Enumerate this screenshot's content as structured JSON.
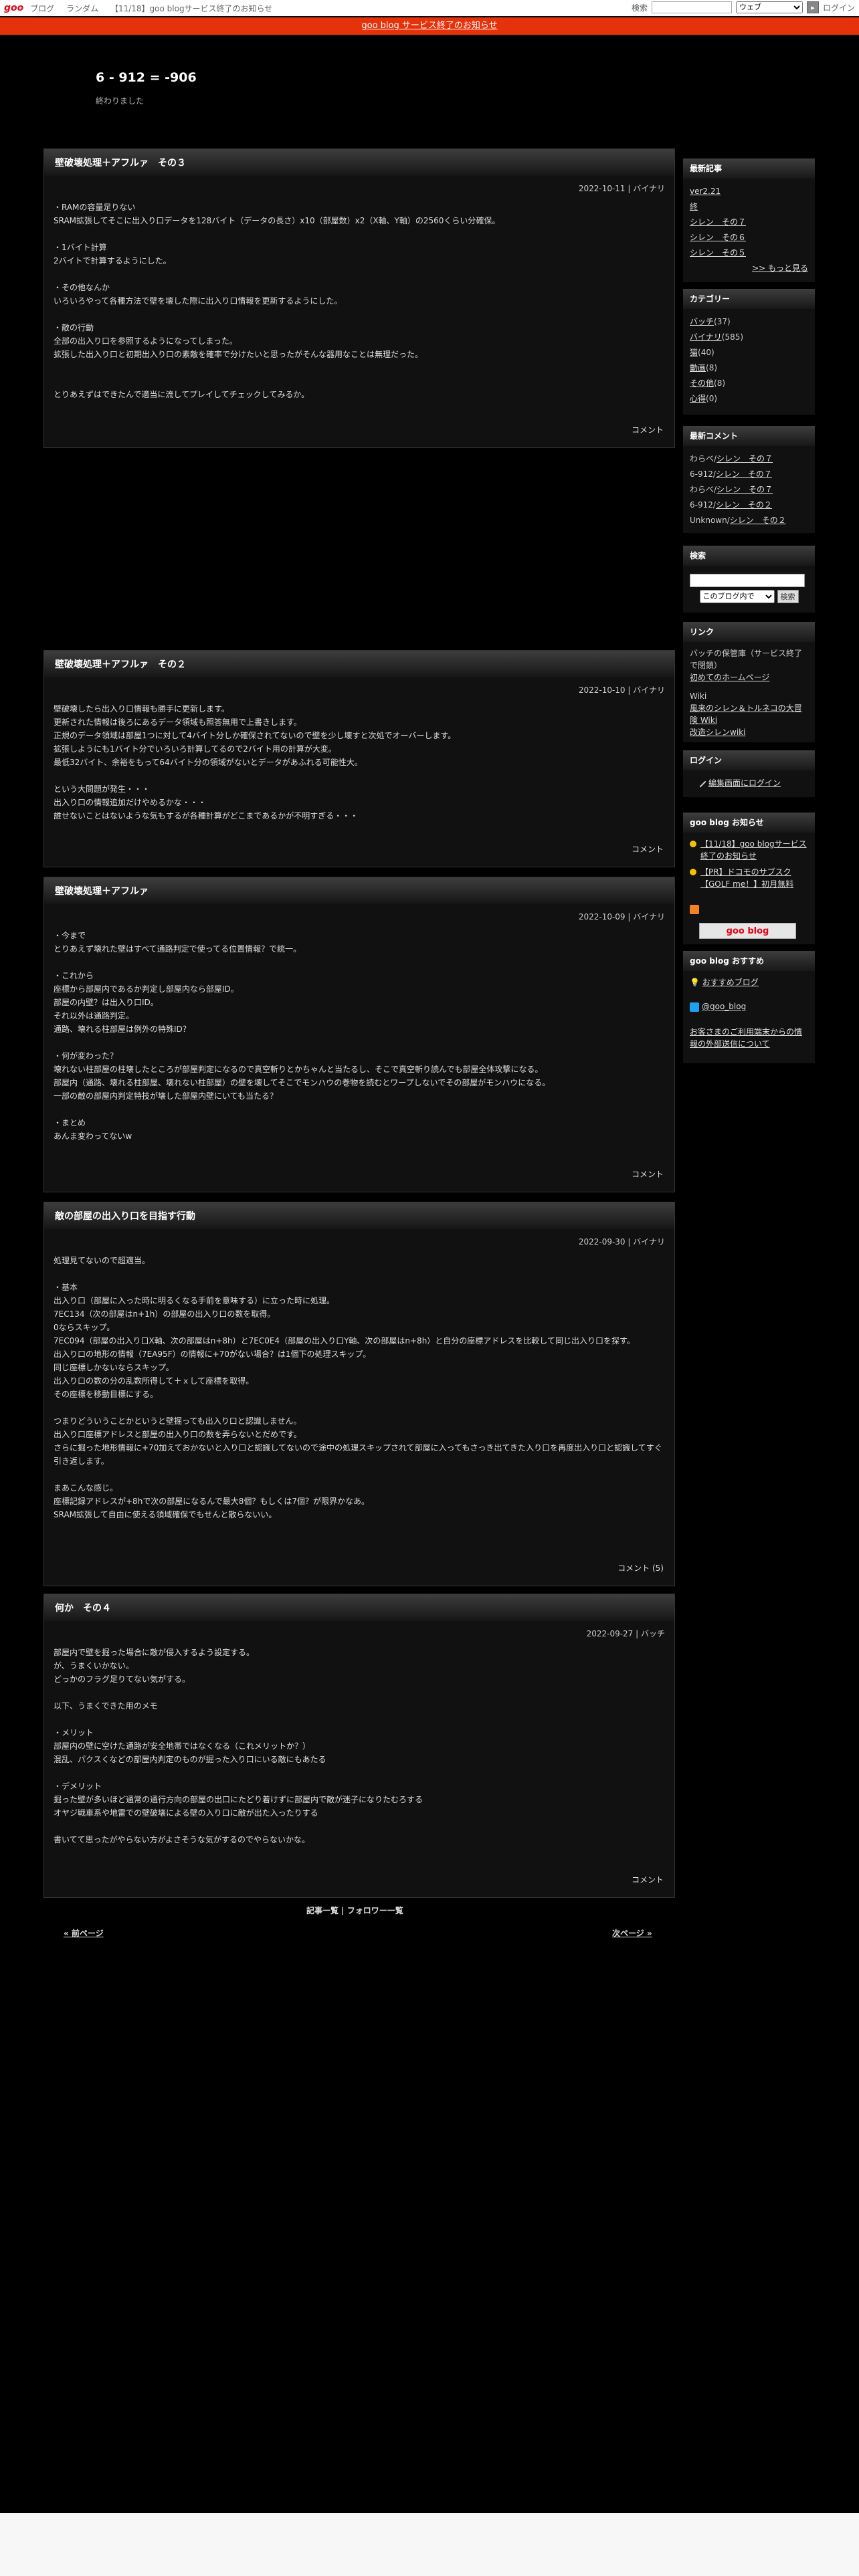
{
  "topbar": {
    "logo": "goo",
    "nav": [
      "ブログ",
      "ランダム",
      "【11/18】goo blogサービス終了のお知らせ"
    ],
    "search_label": "検索",
    "search_scope": "ウェブ",
    "login": "ログイン"
  },
  "notice": "goo blog サービス終了のお知らせ",
  "blog": {
    "title": "6 - 912 = -906",
    "description": "終わりました"
  },
  "posts": [
    {
      "title": "壁破壊処理＋アフルァ　その３",
      "meta": "2022-10-11 | バイナリ",
      "body": "・RAMの容量足りない\nSRAM拡張してそこに出入り口データを128バイト（データの長さ）x10（部屋数）x2（X軸、Y軸）の2560くらい分確保。\n\n・1バイト計算\n2バイトで計算するようにした。\n\n・その他なんか\nいろいろやって各種方法で壁を壊した際に出入り口情報を更新するようにした。\n\n・敵の行動\n全部の出入り口を参照するようになってしまった。\n拡張した出入り口と初期出入り口の素敵を確率で分けたいと思ったがそんな器用なことは無理だった。\n\n\nとりあえずはできたんで適当に流してプレイしてチェックしてみるか。",
      "comment": "コメント"
    },
    {
      "title": "壁破壊処理＋アフルァ　その２",
      "meta": "2022-10-10 | バイナリ",
      "body": "壁破壊したら出入り口情報も勝手に更新します。\n更新された情報は後ろにあるデータ領域も照答無用で上書きします。\n正規のデータ領域は部屋1つに対して4バイト分しか確保されてないので壁を少し壊すと次処でオーバーします。\n拡張しようにも1バイト分でいろいろ計算してるので2バイト用の計算が大変。\n最低32バイト、余裕をもって64バイト分の領域がないとデータがあふれる可能性大。\n\nという大問題が発生・・・\n出入り口の情報追加だけやめるかな・・・\n誰せないことはないような気もするが各種計算がどこまであるかが不明すぎる・・・",
      "comment": "コメント"
    },
    {
      "title": "壁破壊処理＋アフルァ",
      "meta": "2022-10-09 | バイナリ",
      "body": "・今まで\nとりあえず壊れた壁はすべて通路判定で使ってる位置情報？で統一。\n\n・これから\n座標から部屋内であるか判定し部屋内なら部屋ID。\n部屋の内壁？は出入り口ID。\nそれ以外は通路判定。\n通路、壊れる柱部屋は例外の特殊ID？\n\n・何が変わった？\n壊れない柱部屋の柱壊したところが部屋判定になるので真空斬りとかちゃんと当たるし、そこで真空斬り読んでも部屋全体攻撃になる。\n部屋内（通路、壊れる柱部屋、壊れない柱部屋）の壁を壊してそこでモンハウの巻物を読むとワープしないでその部屋がモンハウになる。\n一部の敵の部屋内判定特技が壊した部屋内壁にいても当たる？\n\n・まとめ\nあんま変わってないw",
      "comment": "コメント"
    },
    {
      "title": "敵の部屋の出入り口を目指す行動",
      "meta": "2022-09-30 | バイナリ",
      "body": "処理見てないので超適当。\n\n・基本\n出入り口（部屋に入った時に明るくなる手前を意味する）に立った時に処理。\n7EC134（次の部屋はn+1h）の部屋の出入り口の数を取得。\n0ならスキップ。\n7EC094（部屋の出入り口X軸、次の部屋はn+8h）と7EC0E4（部屋の出入り口Y軸、次の部屋はn+8h）と自分の座標アドレスを比較して同じ出入り口を探す。\n出入り口の地形の情報（7EA95F）の情報に+70がない場合？は1個下の処理スキップ。\n同じ座標しかないならスキップ。\n出入り口の数の分の乱数所得して＋ｘして座標を取得。\nその座標を移動目標にする。\n\nつまりどういうことかというと壁掘っても出入り口と認識しません。\n出入り口座標アドレスと部屋の出入り口の数を弄らないとだめです。\nさらに掘った地形情報に+70加えておかないと入り口と認識してないので途中の処理スキップされて部屋に入ってもさっき出てきた入り口を再度出入り口と認識してすぐ引き返します。\n\nまあこんな感じ。\n座標記録アドレスが+8hで次の部屋になるんで最大8個？もしくは7個？が限界かなあ。\nSRAM拡張して自由に使える領域確保でもせんと散らないい。",
      "comment": "コメント (5)"
    },
    {
      "title": "何か　その４",
      "meta": "2022-09-27 | バッチ",
      "body": "部屋内で壁を掘った場合に敵が侵入するよう設定する。\nが、うまくいかない。\nどっかのフラグ足りてない気がする。\n\n以下、うまくできた用のメモ\n\n・メリット\n部屋内の壁に空けた通路が安全地帯ではなくなる（これメリットか？）\n混乱、パクスくなどの部屋内判定のものが掘った入り口にいる敵にもあたる\n\n・デメリット\n掘った壁が多いほど通常の通行方向の部屋の出口にたどり着けずに部屋内で敵が迷子になりたむろする\nオヤジ戦車系や地雷での壁破壊による壁の入り口に敵が出た入ったりする\n\n書いてて思ったがやらない方がよさそうな気がするのでやらないかな。",
      "comment": "コメント"
    }
  ],
  "pager": {
    "links": "記事一覧 | フォロワー一覧",
    "prev": "« 前ページ",
    "next": "次ページ »"
  },
  "sidebar": {
    "recent": {
      "title": "最新記事",
      "items": [
        "ver2.21",
        "終",
        "シレン　その７",
        "シレン　その６",
        "シレン　その５"
      ],
      "more": ">> もっと見る"
    },
    "categories": {
      "title": "カテゴリー",
      "items": [
        {
          "name": "バッチ",
          "count": "(37)"
        },
        {
          "name": "バイナリ",
          "count": "(585)"
        },
        {
          "name": "猫",
          "count": "(40)"
        },
        {
          "name": "動画",
          "count": "(8)"
        },
        {
          "name": "その他",
          "count": "(8)"
        },
        {
          "name": "心得",
          "count": "(0)"
        }
      ]
    },
    "comments": {
      "title": "最新コメント",
      "items": [
        {
          "who": "わらべ/",
          "post": "シレン　その７"
        },
        {
          "who": "6-912/",
          "post": "シレン　その７"
        },
        {
          "who": "わらべ/",
          "post": "シレン　その７"
        },
        {
          "who": "6-912/",
          "post": "シレン　その２"
        },
        {
          "who": "Unknown/",
          "post": "シレン　その２"
        }
      ]
    },
    "search": {
      "title": "検索",
      "scope": "このブログ内で",
      "button": "検索"
    },
    "links": {
      "title": "リンク",
      "text1": "バッチの保管庫（サービス終了で閉鎖）",
      "link1": "初めてのホームページ",
      "text2": "Wiki",
      "link2": "風来のシレン＆トルネコの大冒険 Wiki",
      "link3": "改造シレンwiki"
    },
    "login": {
      "title": "ログイン",
      "link": "編集画面にログイン"
    },
    "goo_news": {
      "title": "goo blog お知らせ",
      "items": [
        "【11/18】goo blogサービス終了のお知らせ",
        "【PR】ドコモのサブスク【GOLF me！】初月無料"
      ],
      "badge": "goo blog"
    },
    "goo_recommend": {
      "title": "goo blog おすすめ",
      "item": "おすすめブログ",
      "twitter": "@goo_blog",
      "notice": "お客さまのご利用端末からの情報の外部送信について"
    }
  }
}
